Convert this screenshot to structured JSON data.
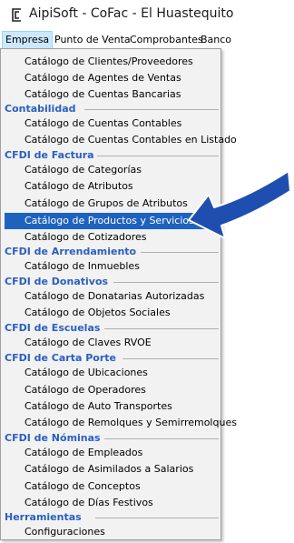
{
  "window": {
    "title": "AipiSoft - CoFac - El Huastequito",
    "icon": "app-logo-icon"
  },
  "menubar": {
    "items": [
      {
        "label": "Empresa",
        "active": true
      },
      {
        "label": "Punto de Venta"
      },
      {
        "label": "Comprobantes"
      },
      {
        "label": "Banco"
      }
    ]
  },
  "dropdown": {
    "sections": [
      {
        "header": "",
        "items": [
          "Catálogo de Clientes/Proveedores",
          "Catálogo de Agentes de Ventas",
          "Catálogo de Cuentas Bancarias"
        ]
      },
      {
        "header": "Contabilidad",
        "items": [
          "Catálogo de Cuentas Contables",
          "Catálogo de Cuentas Contables en Listado"
        ]
      },
      {
        "header": "CFDI de Factura",
        "items": [
          "Catálogo de Categorías",
          "Catálogo de Atributos",
          "Catálogo de Grupos de Atributos",
          "Catálogo de Productos y Servicios",
          "Catálogo de Cotizadores"
        ]
      },
      {
        "header": "CFDI de Arrendamiento",
        "items": [
          "Catálogo de Inmuebles"
        ]
      },
      {
        "header": "CFDI de Donativos",
        "items": [
          "Catálogo de Donatarias Autorizadas",
          "Catálogo de Objetos Sociales"
        ]
      },
      {
        "header": "CFDI de Escuelas",
        "items": [
          "Catálogo de Claves RVOE"
        ]
      },
      {
        "header": "CFDI de Carta Porte",
        "items": [
          "Catálogo de Ubicaciones",
          "Catálogo de Operadores",
          "Catálogo de Auto Transportes",
          "Catálogo de Remolques y Semirremolques"
        ]
      },
      {
        "header": "CFDI de Nóminas",
        "items": [
          "Catálogo de Empleados",
          "Catálogo de Asimilados a Salarios",
          "Catálogo de Conceptos",
          "Catálogo de Días Festivos"
        ]
      },
      {
        "header": "Herramientas",
        "items": [
          "Configuraciones"
        ]
      }
    ],
    "highlighted_item": "Catálogo de Productos y Servicios"
  },
  "colors": {
    "highlight": "#1e62c0",
    "section_header": "#2a5fc0",
    "arrow": "#1e4fb0"
  }
}
